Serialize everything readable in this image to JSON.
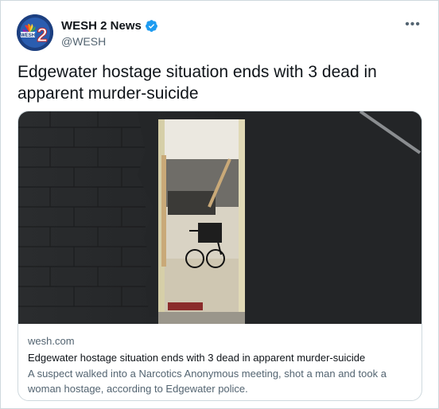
{
  "account": {
    "display_name": "WESH 2 News",
    "handle": "@WESH",
    "verified": true,
    "avatar_digit": "2"
  },
  "tweet": {
    "text": "Edgewater hostage situation ends with 3 dead in apparent murder-suicide"
  },
  "card": {
    "domain": "wesh.com",
    "title": "Edgewater hostage situation ends with 3 dead in apparent murder-suicide",
    "description": "A suspect walked into a Narcotics Anonymous meeting, shot a man and took a woman hostage, according to Edgewater police."
  },
  "colors": {
    "verified_badge": "#1d9bf0",
    "secondary_text": "#536471",
    "primary_text": "#0f1419",
    "border": "#cfd9de"
  }
}
